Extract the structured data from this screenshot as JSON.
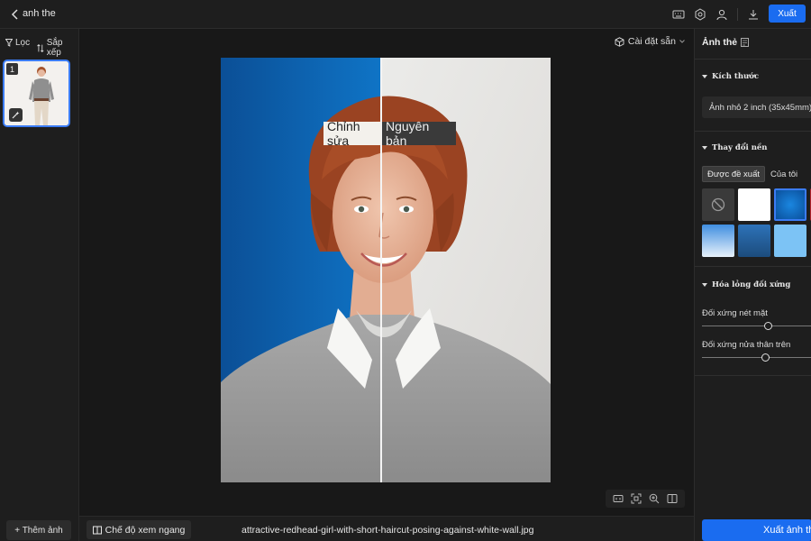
{
  "app": {
    "title": "anh the",
    "export_label": "Xuất"
  },
  "left": {
    "filter_label": "Lọc",
    "sort_label": "Sắp xếp",
    "thumb_number": "1",
    "add_photo_label": "+ Thêm ảnh"
  },
  "center": {
    "preset_label": "Cài đặt sẵn",
    "compare_edited_label": "Chỉnh sửa",
    "compare_original_label": "Nguyên bản",
    "view_mode_label": "Chế độ xem ngang",
    "filename": "attractive-redhead-girl-with-short-haircut-posing-against-white-wall.jpg"
  },
  "right": {
    "panel_title": "Ảnh thẻ",
    "size_section": "Kích thước",
    "size_value": "Ảnh nhỏ 2 inch  (35x45mm)",
    "bg_section": "Thay đổi nền",
    "bg_tabs": [
      "Được đề xuất",
      "Của tôi"
    ],
    "liquify_section": "Hóa lỏng đối xứng",
    "slider1_label": "Đối xứng nét mặt",
    "slider1_value": 0.6,
    "slider2_label": "Đối xứng nửa thân trên",
    "slider2_value": 0.58,
    "export_photo_label": "Xuất ảnh thẻ"
  },
  "colors": {
    "accent": "#1a6cf0",
    "edited_background": "#0e6ab8",
    "original_background": "#e4e3e1"
  }
}
